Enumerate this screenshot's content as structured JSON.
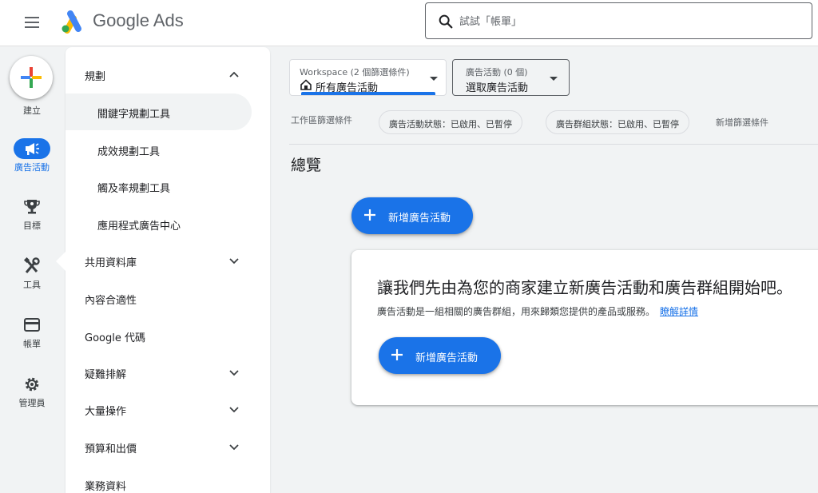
{
  "header": {
    "product_name": "Google Ads",
    "search": {
      "placeholder": "試試「帳單」"
    }
  },
  "rail": {
    "create_label": "建立",
    "items": [
      {
        "label": "廣告活動",
        "icon": "megaphone-icon",
        "active": true
      },
      {
        "label": "目標",
        "icon": "trophy-icon"
      },
      {
        "label": "工具",
        "icon": "tools-icon"
      },
      {
        "label": "帳單",
        "icon": "credit-card-icon"
      },
      {
        "label": "管理員",
        "icon": "gear-icon"
      }
    ]
  },
  "menu": {
    "items": [
      {
        "label": "規劃",
        "expanded": true
      },
      {
        "label": "關鍵字規劃工具",
        "selected": true
      },
      {
        "label": "成效規劃工具"
      },
      {
        "label": "觸及率規劃工具"
      },
      {
        "label": "應用程式廣告中心"
      },
      {
        "label": "共用資料庫"
      },
      {
        "label": "內容合適性"
      },
      {
        "label": "Google 代碼"
      },
      {
        "label": "疑難排解"
      },
      {
        "label": "大量操作"
      },
      {
        "label": "預算和出價"
      },
      {
        "label": "業務資料"
      }
    ]
  },
  "filters": {
    "workspace_label": "Workspace (2 個篩選條件)",
    "workspace_value": "所有廣告活動",
    "campaign_label": "廣告活動 (0 個)",
    "campaign_value": "選取廣告活動",
    "section_label": "工作區篩選條件",
    "chips": [
      "廣告活動狀態：已啟用、已暫停",
      "廣告群組狀態：已啟用、已暫停"
    ],
    "add_filter": "新增篩選條件"
  },
  "main": {
    "overview_title": "總覽",
    "new_campaign_button": "新增廣告活動",
    "card": {
      "title": "讓我們先由為您的商家建立新廣告活動和廣告群組開始吧。",
      "description": "廣告活動是一組相關的廣告群組，用來歸類您提供的產品或服務。",
      "learn_more": "瞭解詳情",
      "button": "新增廣告活動"
    }
  },
  "colors": {
    "primary": "#1a73e8",
    "background": "#f1f3f4",
    "surface": "#ffffff"
  }
}
